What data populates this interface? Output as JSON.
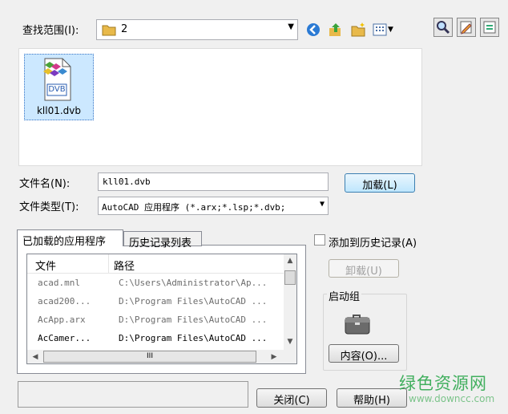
{
  "lookin": {
    "label": "查找范围(I):",
    "value": "2"
  },
  "files": [
    {
      "name": "kll01.dvb",
      "icon_text": "DVB",
      "selected": true
    }
  ],
  "filename": {
    "label": "文件名(N):",
    "value": "kll01.dvb"
  },
  "filetype": {
    "label": "文件类型(T):",
    "value": "AutoCAD 应用程序 (*.arx;*.lsp;*.dvb;"
  },
  "load_button": "加载(L)",
  "tabs": [
    {
      "label": "已加载的应用程序",
      "active": true
    },
    {
      "label": "历史记录列表",
      "active": false
    }
  ],
  "list": {
    "columns": [
      "文件",
      "路径"
    ],
    "rows": [
      {
        "file": "acad.mnl",
        "path": "C:\\Users\\Administrator\\Ap..."
      },
      {
        "file": "acad200...",
        "path": "D:\\Program Files\\AutoCAD ..."
      },
      {
        "file": "AcApp.arx",
        "path": "D:\\Program Files\\AutoCAD ..."
      },
      {
        "file": "AcCamer...",
        "path": "D:\\Program Files\\AutoCAD ..."
      }
    ],
    "hscroll_thumb": "III"
  },
  "add_history": {
    "label": "添加到历史记录(A)",
    "checked": false
  },
  "unload_button": "卸载(U)",
  "startup": {
    "label": "启动组",
    "contents_button": "内容(O)..."
  },
  "status_text": "",
  "close_button": "关闭(C)",
  "help_button": "帮助(H)",
  "watermark": {
    "title": "绿色资源网",
    "url": "www.downcc.com"
  },
  "colors": {
    "selection": "#cce8ff",
    "primary_border": "#3c7fb1",
    "watermark": "#2fa84f"
  }
}
